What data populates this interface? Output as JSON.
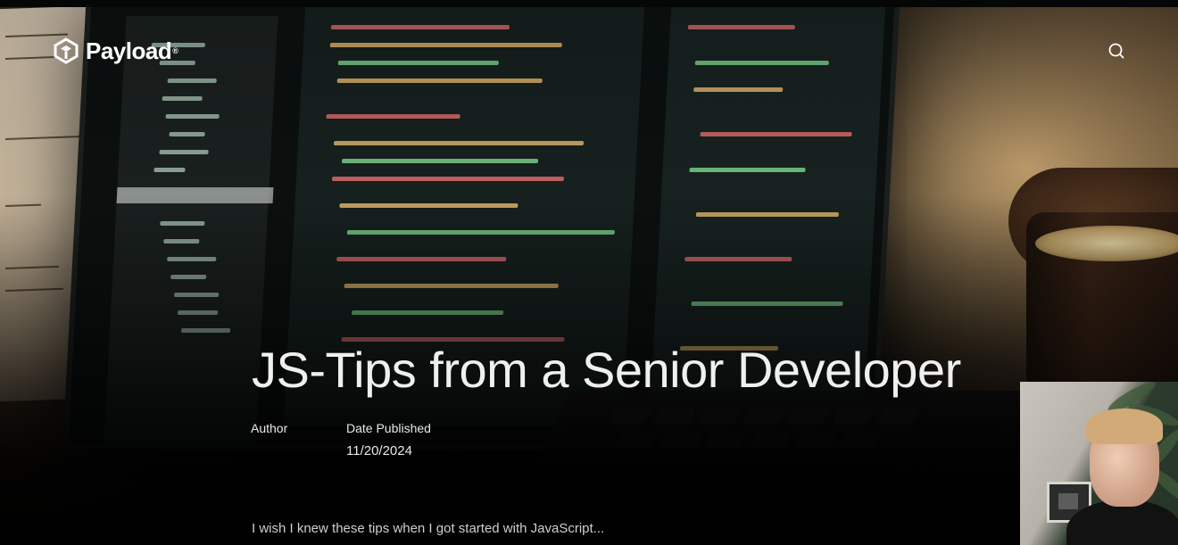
{
  "header": {
    "brand": "Payload",
    "brand_mark": "®",
    "logo_icon": "payload-logo-icon",
    "search_icon": "search-icon"
  },
  "post": {
    "title": "JS-Tips from a Senior Developer",
    "author_label": "Author",
    "author_value": "",
    "date_label": "Date Published",
    "date_value": "11/20/2024",
    "excerpt": "I wish I knew these tips when I got started with JavaScript..."
  },
  "colors": {
    "text": "#efefef",
    "background": "#000000"
  }
}
